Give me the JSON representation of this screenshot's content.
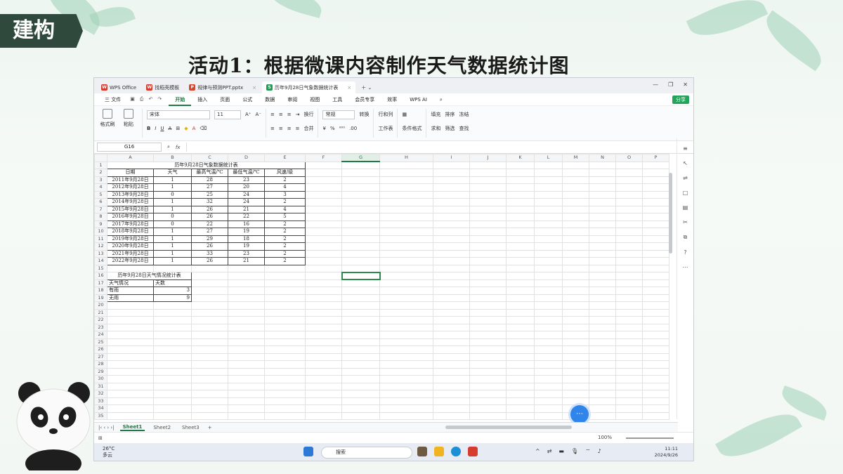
{
  "slide": {
    "badge": "建构",
    "title": "活动1：根据微课内容制作天气数据统计图"
  },
  "tabs": [
    {
      "label": "WPS Office",
      "logo": "W",
      "color": "#d63b2f"
    },
    {
      "label": "找稻壳模板",
      "logo": "W",
      "color": "#d63b2f"
    },
    {
      "label": "规律与预测PPT.pptx",
      "logo": "P",
      "color": "#d4472a"
    },
    {
      "label": "历年9月28日气象数据统计表",
      "logo": "S",
      "color": "#1f9d55"
    }
  ],
  "menu": {
    "file": "三 文件",
    "items": [
      "开始",
      "插入",
      "页面",
      "公式",
      "数据",
      "审阅",
      "视图",
      "工具",
      "会员专享",
      "效率"
    ],
    "ai": "WPS AI",
    "share": "分享"
  },
  "ribbon": {
    "format_painter": "格式刷",
    "paste": "粘贴",
    "font_name": "宋体",
    "font_size": "11",
    "wrap": "换行",
    "merge": "合并",
    "number_format": "常规",
    "convert": "转换",
    "rows_cols": "行和列",
    "worksheet": "工作表",
    "cond_format": "条件格式",
    "fill": "填充",
    "sort": "排序",
    "freeze": "冻结",
    "sum": "求和",
    "filter": "筛选",
    "find": "查找"
  },
  "formula_bar": {
    "name_box": "G16",
    "fx": "fx"
  },
  "columns": [
    "A",
    "B",
    "C",
    "D",
    "E",
    "F",
    "G",
    "H",
    "I",
    "J",
    "K",
    "L",
    "M",
    "N",
    "O",
    "P"
  ],
  "table1": {
    "title": "历年9月28日气象数据统计表",
    "headers": [
      "日期",
      "天气",
      "最高气温/℃",
      "最低气温/℃",
      "风速/级"
    ],
    "rows": [
      [
        "2011年9月28日",
        "1",
        "28",
        "23",
        "2"
      ],
      [
        "2012年9月28日",
        "1",
        "27",
        "20",
        "4"
      ],
      [
        "2013年9月28日",
        "0",
        "25",
        "24",
        "3"
      ],
      [
        "2014年9月28日",
        "1",
        "32",
        "24",
        "2"
      ],
      [
        "2015年9月28日",
        "1",
        "26",
        "21",
        "4"
      ],
      [
        "2016年9月28日",
        "0",
        "26",
        "22",
        "5"
      ],
      [
        "2017年9月28日",
        "0",
        "22",
        "16",
        "2"
      ],
      [
        "2018年9月28日",
        "1",
        "27",
        "19",
        "2"
      ],
      [
        "2019年9月28日",
        "1",
        "29",
        "18",
        "2"
      ],
      [
        "2020年9月28日",
        "1",
        "26",
        "19",
        "2"
      ],
      [
        "2021年9月28日",
        "1",
        "33",
        "23",
        "2"
      ],
      [
        "2022年9月28日",
        "1",
        "26",
        "21",
        "2"
      ]
    ]
  },
  "table2": {
    "title": "历年9月28日天气情况统计表",
    "headers": [
      "天气情况",
      "天数"
    ],
    "rows": [
      [
        "有雨",
        "3"
      ],
      [
        "无雨",
        "9"
      ]
    ]
  },
  "sheet_tabs": [
    "Sheet1",
    "Sheet2",
    "Sheet3"
  ],
  "status": {
    "zoom": "100%"
  },
  "taskbar": {
    "temp": "26°C",
    "weather": "多云",
    "search": "搜索",
    "time": "11:11",
    "date": "2024/9/26"
  }
}
